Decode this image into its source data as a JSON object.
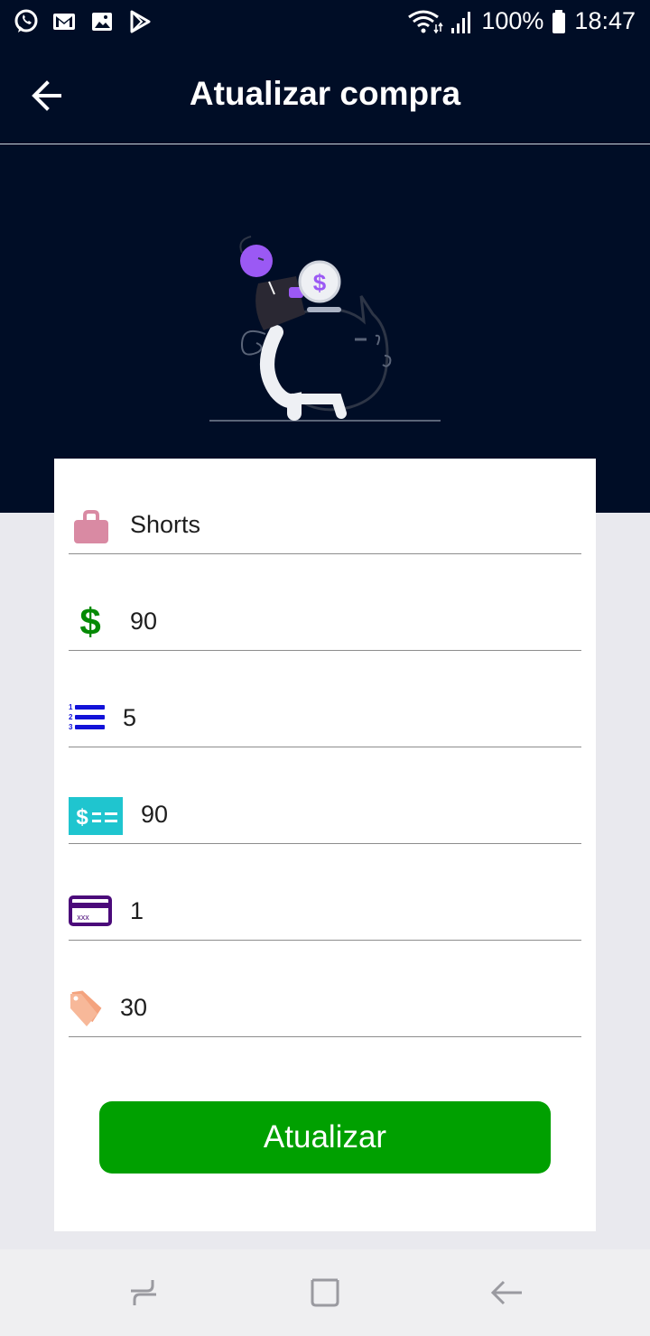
{
  "status_bar": {
    "battery": "100%",
    "time": "18:47",
    "left_icons": [
      "whatsapp-icon",
      "gmail-icon",
      "gallery-icon",
      "play-store-icon"
    ],
    "right_icons": [
      "wifi-icon",
      "signal-icon",
      "battery-icon"
    ]
  },
  "app_bar": {
    "title": "Atualizar compra",
    "back_icon": "arrow-left-icon"
  },
  "form": {
    "fields": [
      {
        "name": "product",
        "icon": "shopping-bag-icon",
        "value": "Shorts"
      },
      {
        "name": "price",
        "icon": "dollar-icon",
        "value": "90"
      },
      {
        "name": "quantity",
        "icon": "numbered-list-icon",
        "value": "5"
      },
      {
        "name": "total",
        "icon": "bill-icon",
        "value": "90"
      },
      {
        "name": "installments",
        "icon": "credit-card-icon",
        "value": "1"
      },
      {
        "name": "discount",
        "icon": "price-tag-icon",
        "value": "30"
      }
    ],
    "submit_label": "Atualizar"
  },
  "colors": {
    "header_bg": "#000d26",
    "submit_bg": "#00a000",
    "bag": "#d98aa3",
    "dollar": "#058a05",
    "list": "#1212d8",
    "bill": "#1fc5cf",
    "card": "#4b0a7a",
    "tag": "#f4a37e"
  },
  "nav_bar": {
    "icons": [
      "recent-apps-icon",
      "home-icon",
      "back-icon"
    ]
  }
}
